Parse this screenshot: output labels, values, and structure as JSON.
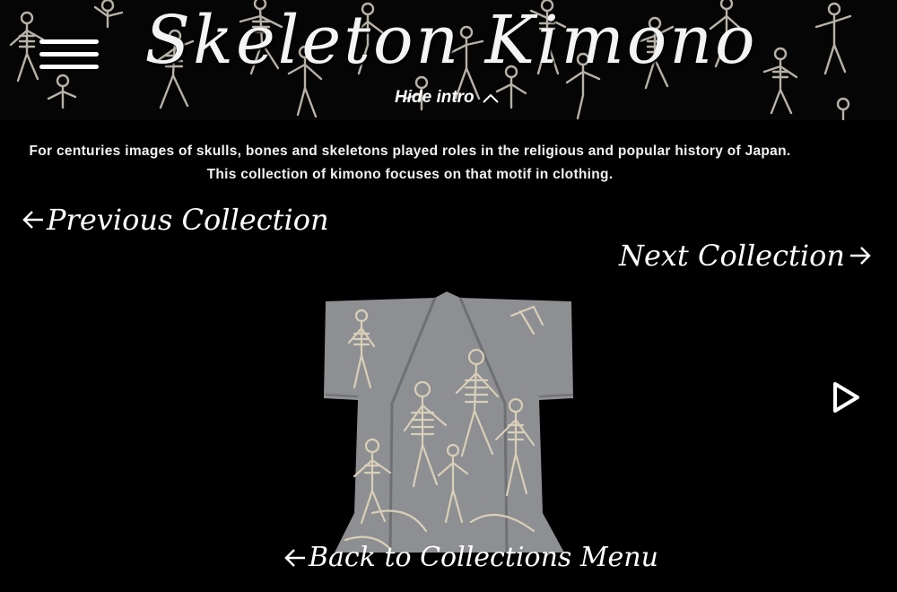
{
  "header": {
    "title": "Skeleton Kimono",
    "menu_icon": "hamburger-menu-icon",
    "hide_intro_label": "Hide intro",
    "hide_intro_icon": "chevron-up-icon"
  },
  "intro": {
    "line1": "For centuries images of skulls, bones and skeletons played roles in the religious and popular history of Japan.",
    "line2": "This collection of kimono focuses on that motif in clothing."
  },
  "navigation": {
    "previous_label": "Previous Collection",
    "next_label": "Next Collection",
    "back_label": "Back to Collections Menu"
  },
  "gallery": {
    "image_alt": "Grey kimono decorated with dancing skeletons",
    "play_icon": "play-icon"
  },
  "colors": {
    "background": "#000000",
    "text": "#ffffff",
    "kimono": "#8d8f93"
  }
}
